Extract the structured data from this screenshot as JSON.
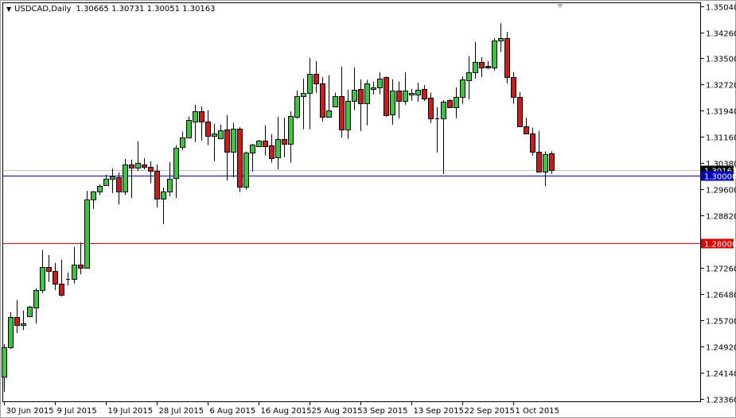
{
  "header": {
    "symbol": "USDCAD,Daily",
    "ohlc": "1.30665 1.30731 1.30051 1.30163"
  },
  "colors": {
    "bull": "#32CD32",
    "bear": "#DC1414",
    "wick": "#000000",
    "level_blue": "#0000C8",
    "level_red": "#E00000",
    "bid_line": "#C0C0C0",
    "bid_label_bg": "#000000"
  },
  "chart_data": {
    "type": "candlestick",
    "title": "USDCAD,Daily",
    "ylim": [
      1.2336,
      1.3504
    ],
    "y_ticks": [
      "1.35040",
      "1.34260",
      "1.33500",
      "1.32720",
      "1.31940",
      "1.31160",
      "1.30380",
      "1.29600",
      "1.28820",
      "1.27260",
      "1.26480",
      "1.25700",
      "1.24920",
      "1.24140",
      "1.23360"
    ],
    "x_labels": [
      {
        "index": 0,
        "label": "30 Jun 2015"
      },
      {
        "index": 8,
        "label": "9 Jul 2015"
      },
      {
        "index": 16,
        "label": "19 Jul 2015"
      },
      {
        "index": 24,
        "label": "28 Jul 2015"
      },
      {
        "index": 32,
        "label": "6 Aug 2015"
      },
      {
        "index": 40,
        "label": "16 Aug 2015"
      },
      {
        "index": 48,
        "label": "25 Aug 2015"
      },
      {
        "index": 56,
        "label": "3 Sep 2015"
      },
      {
        "index": 64,
        "label": "13 Sep 2015"
      },
      {
        "index": 72,
        "label": "22 Sep 2015"
      },
      {
        "index": 80,
        "label": "1 Oct 2015"
      }
    ],
    "levels": [
      {
        "price": 1.30163,
        "label": "1.30163",
        "kind": "bid"
      },
      {
        "price": 1.3,
        "label": "1.30000",
        "kind": "blue"
      },
      {
        "price": 1.28,
        "label": "1.28000",
        "kind": "red"
      }
    ],
    "ohlc": [
      [
        1.2402,
        1.2499,
        1.2357,
        1.249
      ],
      [
        1.249,
        1.2594,
        1.2485,
        1.258
      ],
      [
        1.258,
        1.263,
        1.2532,
        1.2556
      ],
      [
        1.2556,
        1.2599,
        1.2541,
        1.256
      ],
      [
        1.2582,
        1.2613,
        1.258,
        1.2611
      ],
      [
        1.2608,
        1.2665,
        1.256,
        1.266
      ],
      [
        1.266,
        1.2779,
        1.2651,
        1.2729
      ],
      [
        1.2729,
        1.2764,
        1.2684,
        1.2717
      ],
      [
        1.2717,
        1.2741,
        1.266,
        1.2679
      ],
      [
        1.2679,
        1.275,
        1.2641,
        1.2646
      ],
      [
        1.2693,
        1.2712,
        1.2674,
        1.2694
      ],
      [
        1.2693,
        1.2788,
        1.2679,
        1.2736
      ],
      [
        1.2736,
        1.2802,
        1.2707,
        1.2726
      ],
      [
        1.2726,
        1.2955,
        1.2724,
        1.2929
      ],
      [
        1.2929,
        1.2955,
        1.2901,
        1.2953
      ],
      [
        1.2953,
        1.2974,
        1.2943,
        1.297
      ],
      [
        1.2972,
        1.3003,
        1.297,
        1.2991
      ],
      [
        1.2991,
        1.3022,
        1.2948,
        1.2998
      ],
      [
        1.2996,
        1.301,
        1.2915,
        1.2953
      ],
      [
        1.2953,
        1.305,
        1.2943,
        1.3033
      ],
      [
        1.3033,
        1.3048,
        1.2934,
        1.3024
      ],
      [
        1.3024,
        1.3102,
        1.3015,
        1.3038
      ],
      [
        1.3033,
        1.3052,
        1.3019,
        1.3026
      ],
      [
        1.3026,
        1.3043,
        1.2977,
        1.3015
      ],
      [
        1.3015,
        1.3033,
        1.2906,
        1.2932
      ],
      [
        1.2932,
        1.2965,
        1.2856,
        1.2953
      ],
      [
        1.2953,
        1.3041,
        1.2939,
        1.2991
      ],
      [
        1.2993,
        1.3091,
        1.2934,
        1.3084
      ],
      [
        1.3086,
        1.3131,
        1.3077,
        1.3114
      ],
      [
        1.3114,
        1.3176,
        1.3112,
        1.3166
      ],
      [
        1.3162,
        1.3211,
        1.31,
        1.3192
      ],
      [
        1.3192,
        1.3206,
        1.3105,
        1.3162
      ],
      [
        1.3162,
        1.3195,
        1.3091,
        1.3119
      ],
      [
        1.3119,
        1.3154,
        1.3043,
        1.3126
      ],
      [
        1.3112,
        1.3152,
        1.311,
        1.3136
      ],
      [
        1.3138,
        1.3181,
        1.2986,
        1.3072
      ],
      [
        1.3072,
        1.3157,
        1.2996,
        1.314
      ],
      [
        1.314,
        1.3145,
        1.2951,
        1.2967
      ],
      [
        1.2967,
        1.3072,
        1.2958,
        1.3069
      ],
      [
        1.3069,
        1.3095,
        1.3012,
        1.3093
      ],
      [
        1.3088,
        1.3107,
        1.3086,
        1.3105
      ],
      [
        1.3105,
        1.315,
        1.306,
        1.3088
      ],
      [
        1.3091,
        1.3124,
        1.3039,
        1.3053
      ],
      [
        1.3055,
        1.3176,
        1.3019,
        1.311
      ],
      [
        1.311,
        1.3173,
        1.3055,
        1.3095
      ],
      [
        1.3095,
        1.3192,
        1.3039,
        1.3178
      ],
      [
        1.3176,
        1.3254,
        1.3169,
        1.3237
      ],
      [
        1.3237,
        1.3289,
        1.3138,
        1.3247
      ],
      [
        1.3247,
        1.3351,
        1.3138,
        1.3304
      ],
      [
        1.3304,
        1.3341,
        1.3247,
        1.3275
      ],
      [
        1.3275,
        1.3294,
        1.3162,
        1.3176
      ],
      [
        1.3176,
        1.3299,
        1.3174,
        1.3195
      ],
      [
        1.3207,
        1.3247,
        1.3204,
        1.3237
      ],
      [
        1.3237,
        1.3325,
        1.3114,
        1.3138
      ],
      [
        1.3138,
        1.3256,
        1.311,
        1.3223
      ],
      [
        1.3223,
        1.3322,
        1.3195,
        1.3256
      ],
      [
        1.3259,
        1.3287,
        1.3133,
        1.3216
      ],
      [
        1.3216,
        1.3285,
        1.315,
        1.3275
      ],
      [
        1.3259,
        1.328,
        1.3242,
        1.3263
      ],
      [
        1.3263,
        1.3308,
        1.3242,
        1.3289
      ],
      [
        1.3294,
        1.3296,
        1.3176,
        1.3181
      ],
      [
        1.3183,
        1.3287,
        1.3152,
        1.3254
      ],
      [
        1.3254,
        1.328,
        1.3171,
        1.3223
      ],
      [
        1.3223,
        1.3308,
        1.3211,
        1.3254
      ],
      [
        1.3242,
        1.3259,
        1.3223,
        1.3247
      ],
      [
        1.3242,
        1.3277,
        1.3221,
        1.3256
      ],
      [
        1.3259,
        1.327,
        1.3223,
        1.323
      ],
      [
        1.3233,
        1.3247,
        1.3157,
        1.3171
      ],
      [
        1.3171,
        1.3204,
        1.3069,
        1.317
      ],
      [
        1.3171,
        1.3225,
        1.3005,
        1.3221
      ],
      [
        1.3225,
        1.3228,
        1.3202,
        1.3204
      ],
      [
        1.3204,
        1.3263,
        1.3171,
        1.3235
      ],
      [
        1.3235,
        1.3296,
        1.3214,
        1.3287
      ],
      [
        1.3285,
        1.3355,
        1.3228,
        1.3308
      ],
      [
        1.3308,
        1.3398,
        1.3289,
        1.3339
      ],
      [
        1.3339,
        1.3353,
        1.3294,
        1.3322
      ],
      [
        1.3327,
        1.3341,
        1.3318,
        1.3322
      ],
      [
        1.3322,
        1.341,
        1.3313,
        1.3402
      ],
      [
        1.3402,
        1.3454,
        1.3369,
        1.341
      ],
      [
        1.341,
        1.3428,
        1.3275,
        1.3294
      ],
      [
        1.3294,
        1.3308,
        1.3214,
        1.3235
      ],
      [
        1.3235,
        1.3249,
        1.3145,
        1.3147
      ],
      [
        1.3147,
        1.3173,
        1.3124,
        1.3126
      ],
      [
        1.3126,
        1.3143,
        1.306,
        1.3072
      ],
      [
        1.3072,
        1.3133,
        1.301,
        1.3013
      ],
      [
        1.3013,
        1.3072,
        1.2969,
        1.3065
      ],
      [
        1.30665,
        1.30731,
        1.30051,
        1.30163
      ]
    ]
  }
}
